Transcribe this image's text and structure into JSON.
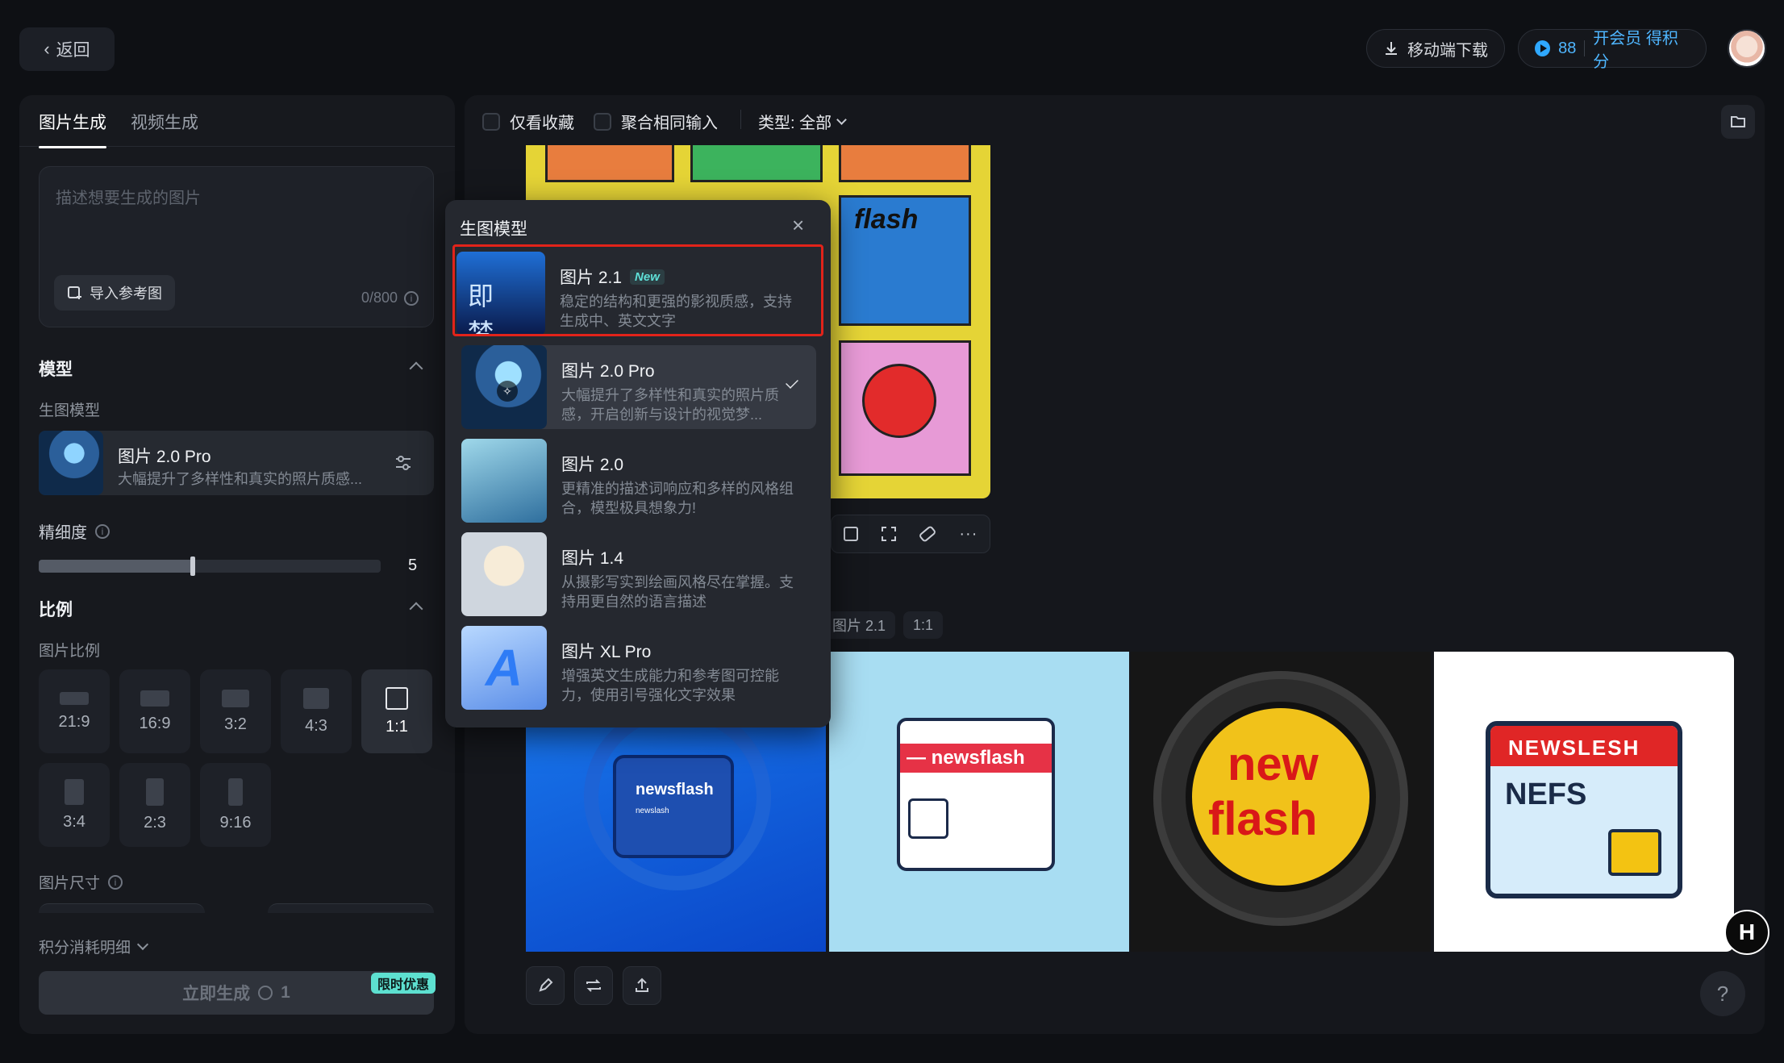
{
  "topbar": {
    "back_label": "返回",
    "mobile_download": "移动端下载",
    "points": "88",
    "member_link": "开会员 得积分"
  },
  "left": {
    "tabs": [
      "图片生成",
      "视频生成"
    ],
    "prompt_placeholder": "描述想要生成的图片",
    "import_ref": "导入参考图",
    "counter": "0/800",
    "model_section": "模型",
    "gen_model_label": "生图模型",
    "selected_model": {
      "name": "图片 2.0 Pro",
      "desc": "大幅提升了多样性和真实的照片质感..."
    },
    "detail_label": "精细度",
    "detail_value": "5",
    "detail_fraction": 0.45,
    "ratio_section": "比例",
    "ratio_label": "图片比例",
    "ratios": [
      "21:9",
      "16:9",
      "3:2",
      "4:3",
      "1:1",
      "3:4",
      "2:3",
      "9:16"
    ],
    "selected_ratio": "1:1",
    "size_label": "图片尺寸",
    "cost_detail": "积分消耗明细",
    "generate_label": "立即生成",
    "generate_cost": "1",
    "promo_badge": "限时优惠"
  },
  "filters": {
    "favorites_only": "仅看收藏",
    "merge_same": "聚合相同输入",
    "type_filter": "类型: 全部"
  },
  "result_tags": [
    "图片 2.1",
    "1:1"
  ],
  "thumb_text": {
    "flash": "flash",
    "newsflash_1": "newsflash",
    "newsflash_1_sub": "newslash",
    "newsflash_2": "— newsflash",
    "new": "new",
    "flash_2": "flash",
    "newsflesh": "NEWSLESH",
    "nefs": "NEFS",
    "jimeng": "即 梦"
  },
  "dropdown": {
    "title": "生图模型",
    "new_badge": "New",
    "items": [
      {
        "name": "图片 2.1",
        "desc": "稳定的结构和更强的影视质感，支持生成中、英文文字"
      },
      {
        "name": "图片 2.0 Pro",
        "desc": "大幅提升了多样性和真实的照片质感，开启创新与设计的视觉梦..."
      },
      {
        "name": "图片 2.0",
        "desc": "更精准的描述词响应和多样的风格组合，模型极具想象力!"
      },
      {
        "name": "图片 1.4",
        "desc": "从摄影写实到绘画风格尽在掌握。支持用更自然的语言描述"
      },
      {
        "name": "图片 XL Pro",
        "desc": "增强英文生成能力和参考图可控能力，使用引号强化文字效果"
      }
    ]
  },
  "help_label": "?",
  "h_label": "H"
}
